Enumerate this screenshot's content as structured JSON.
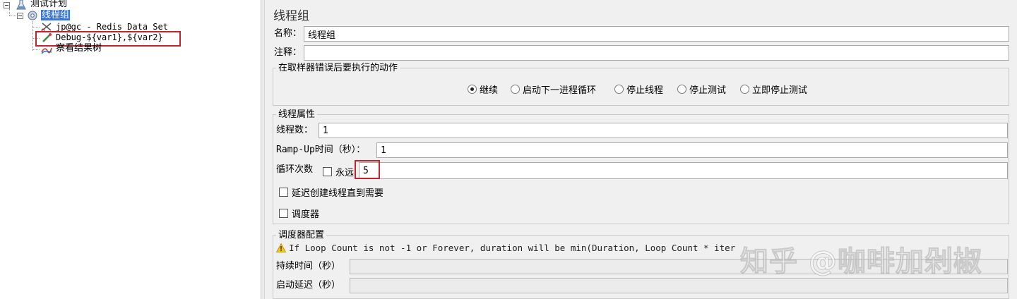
{
  "tree": {
    "items": [
      {
        "label": "测试计划"
      },
      {
        "label": "线程组"
      },
      {
        "label": "jp@gc - Redis Data Set"
      },
      {
        "label": "Debug-${var1},${var2}"
      },
      {
        "label": "察看结果树"
      }
    ]
  },
  "panel": {
    "title": "线程组",
    "name_label": "名称：",
    "name_value": "线程组",
    "comment_label": "注释：",
    "comment_value": "",
    "sampler_error": {
      "group_title": "在取样器错误后要执行的动作",
      "options": [
        "继续",
        "启动下一进程循环",
        "停止线程",
        "停止测试",
        "立即停止测试"
      ],
      "selected": "继续"
    },
    "thread_props": {
      "group_title": "线程属性",
      "threads_label": "线程数：",
      "threads_value": "1",
      "rampup_label": "Ramp-Up时间（秒）：",
      "rampup_value": "1",
      "loop_label": "循环次数",
      "forever_label": "永远",
      "loop_value": "5",
      "delay_label": "延迟创建线程直到需要",
      "scheduler_label": "调度器"
    },
    "scheduler_config": {
      "group_title": "调度器配置",
      "warning": "If Loop Count is not -1 or Forever, duration will be min(Duration, Loop Count * iter",
      "duration_label": "持续时间（秒）",
      "duration_value": "",
      "startup_delay_label": "启动延迟（秒）",
      "startup_delay_value": ""
    }
  },
  "watermark": "知乎 @咖啡加剁椒",
  "colors": {
    "selection": "#3875d7",
    "highlight_box": "#c0252e",
    "panel_bg": "#f0f0f0"
  }
}
